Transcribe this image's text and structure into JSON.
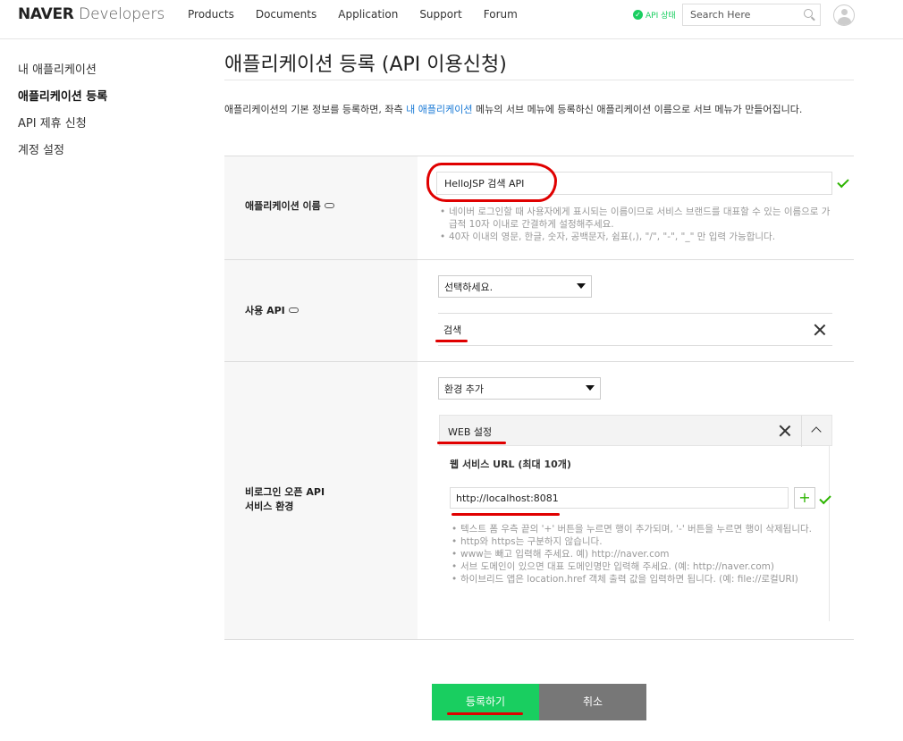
{
  "header": {
    "logo_bold": "NAVER",
    "logo_light": "Developers",
    "nav": [
      "Products",
      "Documents",
      "Application",
      "Support",
      "Forum"
    ],
    "api_status": "API 상태",
    "search_placeholder": "Search Here"
  },
  "sidebar": {
    "items": [
      {
        "label": "내 애플리케이션"
      },
      {
        "label": "애플리케이션 등록"
      },
      {
        "label": "API 제휴 신청"
      },
      {
        "label": "계정 설정"
      }
    ]
  },
  "main": {
    "title": "애플리케이션 등록 (API 이용신청)",
    "desc_before": "애플리케이션의 기본 정보를 등록하면, 좌측 ",
    "desc_link": "내 애플리케이션",
    "desc_after": " 메뉴의 서브 메뉴에 등록하신 애플리케이션 이름으로 서브 메뉴가 만들어집니다."
  },
  "form": {
    "app_name": {
      "label": "애플리케이션 이름",
      "value": "HelloJSP 검색 API",
      "guides": [
        "네이버 로그인할 때 사용자에게 표시되는 이름이므로 서비스 브랜드를 대표할 수 있는 이름으로 가급적 10자 이내로 간결하게 설정해주세요.",
        "40자 이내의 영문, 한글, 숫자, 공백문자, 쉼표(,), \"/\", \"-\", \"_\" 만 입력 가능합니다."
      ]
    },
    "use_api": {
      "label": "사용 API",
      "select": "선택하세요.",
      "selected_item": "검색"
    },
    "env": {
      "label_line1": "비로그인 오픈 API",
      "label_line2": "서비스 환경",
      "select": "환경 추가",
      "web_title": "WEB 설정",
      "url_title": "웹 서비스 URL (최대 10개)",
      "url_value": "http://localhost:8081",
      "plus": "+",
      "guides": [
        "텍스트 폼 우측 끝의 '+' 버튼을 누르면 행이 추가되며, '-' 버튼을 누르면 행이 삭제됩니다.",
        "http와 https는 구분하지 않습니다.",
        "www는 빼고 입력해 주세요. 예) http://naver.com",
        "서브 도메인이 있으면 대표 도메인명만 입력해 주세요. (예: http://naver.com)",
        "하이브리드 앱은 location.href 객체 출력 값을 입력하면 됩니다. (예: file://로컬URI)"
      ]
    }
  },
  "buttons": {
    "submit": "등록하기",
    "cancel": "취소"
  },
  "colors": {
    "brand_green": "#19ce60",
    "check_green": "#2db400",
    "link_blue": "#1a7ad6",
    "annotation_red": "#e00000"
  }
}
